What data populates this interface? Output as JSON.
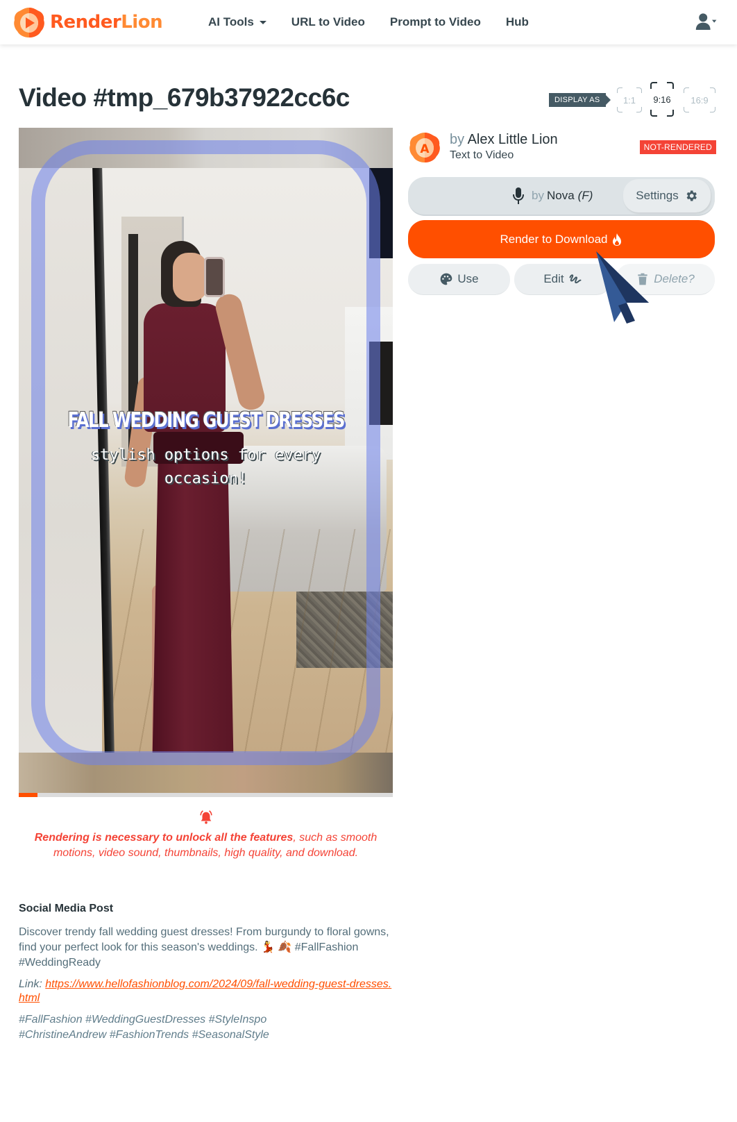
{
  "nav": {
    "brand_render": "Render",
    "brand_lion": "Lion",
    "links": [
      {
        "label": "AI Tools",
        "has_dropdown": true
      },
      {
        "label": "URL to Video"
      },
      {
        "label": "Prompt to Video"
      },
      {
        "label": "Hub"
      }
    ],
    "user_icon": "user-icon"
  },
  "page": {
    "title": "Video #tmp_679b37922cc6c",
    "display_as_label": "DISPLAY AS",
    "ratios": [
      {
        "label": "1:1",
        "active": false
      },
      {
        "label": "9:16",
        "active": true
      },
      {
        "label": "16:9",
        "active": false
      }
    ]
  },
  "video": {
    "caption_title": "FALL WEDDING GUEST DRESSES",
    "caption_sub": "stylish options for every occasion!",
    "progress_percent": 5
  },
  "notice": {
    "icon": "bell-icon",
    "bold": "Rendering is necessary to unlock all the features",
    "rest": ", such as smooth motions, video sound, thumbnails, high quality, and download."
  },
  "social": {
    "heading": "Social Media Post",
    "body": "Discover trendy fall wedding guest dresses! From burgundy to floral gowns, find your perfect look for this season's weddings. 💃 🍂 #FallFashion #WeddingReady",
    "link_label": "Link: ",
    "link_url": "https://www.hellofashionblog.com/2024/09/fall-wedding-guest-dresses.html",
    "tags_line1": "#FallFashion #WeddingGuestDresses #StyleInspo",
    "tags_line2": "#ChristineAndrew #FashionTrends #SeasonalStyle"
  },
  "author": {
    "avatar_letter": "A",
    "by": "by",
    "name": "Alex Little Lion",
    "type": "Text to Video",
    "status": "NOT-RENDERED"
  },
  "voice": {
    "by": "by",
    "name": "Nova",
    "gender": "(F)",
    "settings_label": "Settings"
  },
  "actions": {
    "render_label": "Render to Download",
    "use_label": "Use",
    "edit_label": "Edit",
    "delete_label": "Delete?"
  },
  "colors": {
    "accent": "#ff4f00",
    "danger": "#f44336",
    "text": "#263238"
  }
}
